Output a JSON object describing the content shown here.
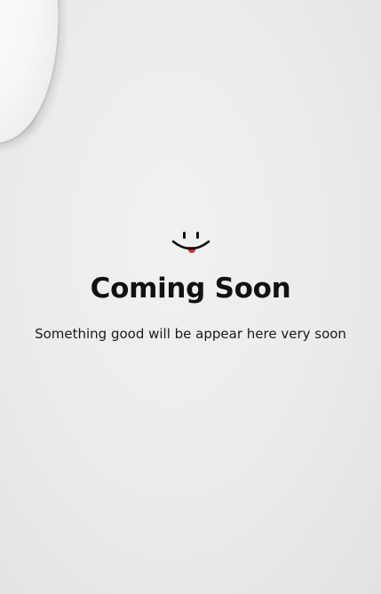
{
  "page": {
    "background_color": "#ebebeb",
    "icon": "smiley-tongue-icon",
    "heading": "Coming Soon",
    "message": "Something good will be appear here very soon"
  },
  "colors": {
    "text": "#111111",
    "tongue": "#d4343c"
  }
}
